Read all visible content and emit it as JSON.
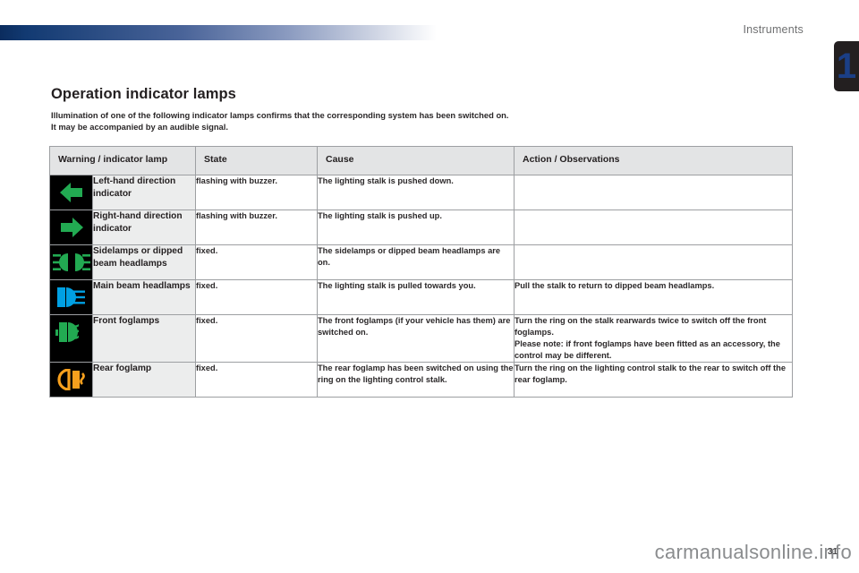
{
  "header": {
    "section_title": "Instruments",
    "chapter_number": "1"
  },
  "heading": {
    "title": "Operation indicator lamps",
    "intro_line1": "Illumination of one of the following indicator lamps confirms that the corresponding system has been switched on.",
    "intro_line2": "It may be accompanied by an audible signal."
  },
  "table": {
    "columns": [
      "Warning / indicator lamp",
      "State",
      "Cause",
      "Action / Observations"
    ],
    "rows": [
      {
        "icon": "left-direction-arrow-icon",
        "icon_color": "#22aa52",
        "name": "Left-hand direction indicator",
        "state": "flashing with buzzer.",
        "cause": "The lighting stalk is pushed down.",
        "action": ""
      },
      {
        "icon": "right-direction-arrow-icon",
        "icon_color": "#22aa52",
        "name": "Right-hand direction indicator",
        "state": "flashing with buzzer.",
        "cause": "The lighting stalk is pushed up.",
        "action": ""
      },
      {
        "icon": "sidelamps-icon",
        "icon_color": "#22aa52",
        "name": "Sidelamps or dipped beam headlamps",
        "state": "fixed.",
        "cause": "The sidelamps or dipped beam headlamps are on.",
        "action": ""
      },
      {
        "icon": "main-beam-headlamps-icon",
        "icon_color": "#00a0e3",
        "name": "Main beam headlamps",
        "state": "fixed.",
        "cause": "The lighting stalk is pulled towards you.",
        "action": "Pull the stalk to return to dipped beam headlamps."
      },
      {
        "icon": "front-foglamps-icon",
        "icon_color": "#22aa52",
        "name": "Front foglamps",
        "state": "fixed.",
        "cause": "The front foglamps (if your vehicle has them) are switched on.",
        "action": "Turn the ring on the stalk rearwards twice to switch off the front foglamps.\nPlease note: if front foglamps have been fitted as an accessory, the control may be different."
      },
      {
        "icon": "rear-foglamp-icon",
        "icon_color": "#f7a01d",
        "name": "Rear foglamp",
        "state": "fixed.",
        "cause": "The rear foglamp has been switched on using the ring on the lighting control stalk.",
        "action": "Turn the ring on the lighting control stalk to the rear to switch off the rear foglamp."
      }
    ]
  },
  "footer": {
    "watermark": "carmanualsonline.info",
    "page_number": "31"
  }
}
